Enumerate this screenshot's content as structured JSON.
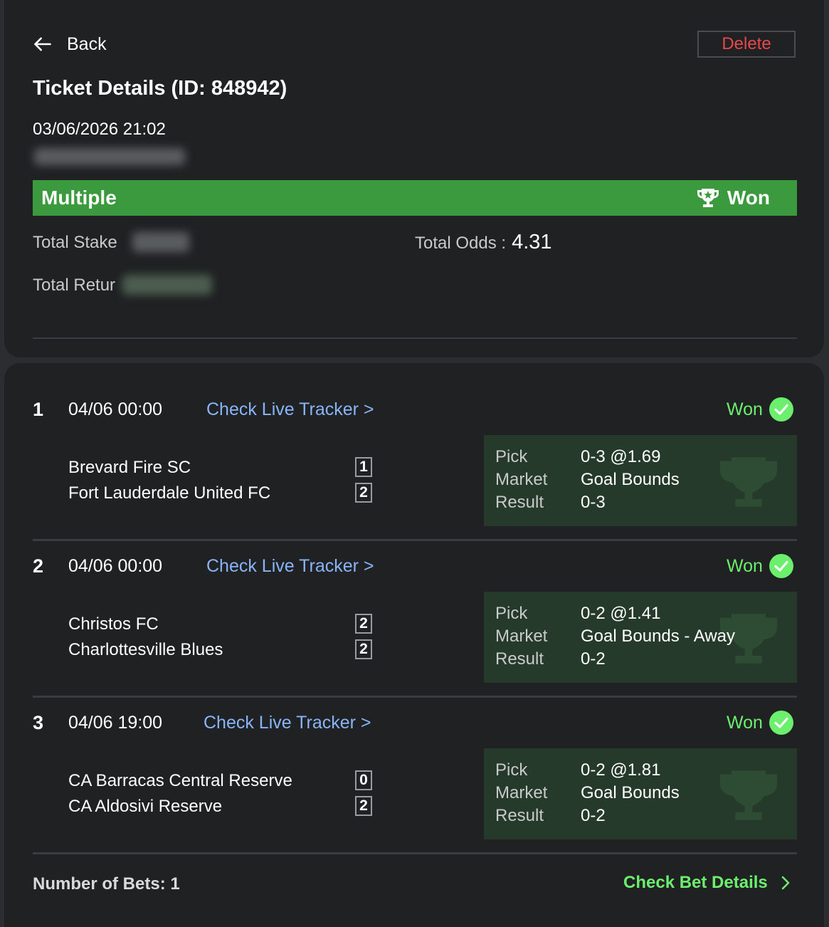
{
  "header": {
    "back_label": "Back",
    "delete_label": "Delete",
    "title": "Ticket Details (ID: 848942)",
    "datetime": "03/06/2026 21:02"
  },
  "banner": {
    "bet_type": "Multiple",
    "status": "Won"
  },
  "summary": {
    "total_stake_label": "Total Stake",
    "total_odds_label": "Total Odds :",
    "total_odds_value": "4.31",
    "total_return_label": "Total Retur"
  },
  "selections": [
    {
      "number": "1",
      "time": "04/06 00:00",
      "tracker_label": "Check Live Tracker >",
      "status": "Won",
      "home": "Brevard Fire SC",
      "away": "Fort Lauderdale United FC",
      "home_score": "1",
      "away_score": "2",
      "pick_label": "Pick",
      "pick": "0-3 @1.69",
      "market_label": "Market",
      "market": "Goal Bounds",
      "result_label": "Result",
      "result": "0-3"
    },
    {
      "number": "2",
      "time": "04/06 00:00",
      "tracker_label": "Check Live Tracker >",
      "status": "Won",
      "home": "Christos FC",
      "away": "Charlottesville Blues",
      "home_score": "2",
      "away_score": "2",
      "pick_label": "Pick",
      "pick": "0-2 @1.41",
      "market_label": "Market",
      "market": "Goal Bounds - Away",
      "result_label": "Result",
      "result": "0-2"
    },
    {
      "number": "3",
      "time": "04/06 19:00",
      "tracker_label": "Check Live Tracker >",
      "status": "Won",
      "home": "CA Barracas Central Reserve",
      "away": "CA Aldosivi Reserve",
      "home_score": "0",
      "away_score": "2",
      "pick_label": "Pick",
      "pick": "0-2 @1.81",
      "market_label": "Market",
      "market": "Goal Bounds",
      "result_label": "Result",
      "result": "0-2"
    }
  ],
  "footer": {
    "bets_count": "Number of Bets: 1",
    "details_link": "Check Bet Details"
  },
  "colors": {
    "win_green": "#3b9a3d",
    "won_text": "#6cef6c",
    "link_blue": "#8ab4f8",
    "delete_red": "#e5484d"
  }
}
